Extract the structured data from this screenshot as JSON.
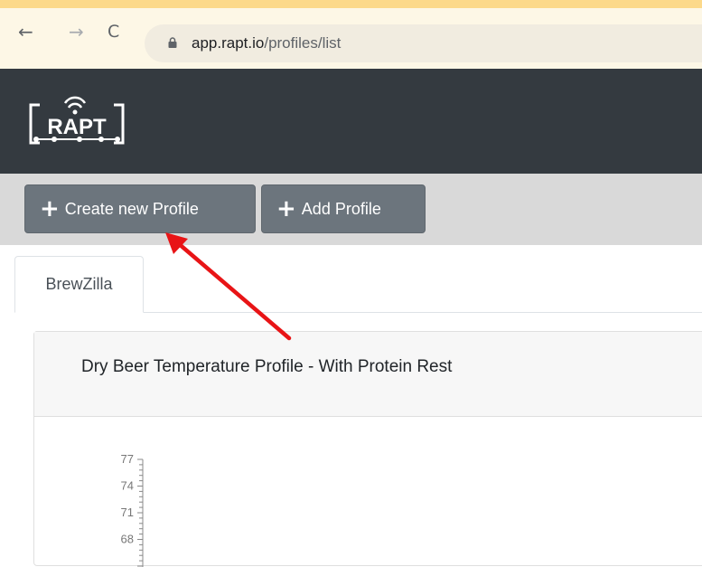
{
  "browser": {
    "url_domain": "app.rapt.io",
    "url_path": "/profiles/list",
    "back_icon": "arrow-left",
    "forward_icon": "arrow-right",
    "reload_icon": "reload",
    "lock_icon": "lock"
  },
  "app": {
    "logo_text": "RAPT"
  },
  "toolbar": {
    "create_label": "Create new Profile",
    "add_label": "Add Profile"
  },
  "tabs": [
    {
      "label": "BrewZilla"
    }
  ],
  "card": {
    "title": "Dry Beer Temperature Profile - With Protein Rest"
  },
  "chart_data": {
    "type": "line",
    "y_ticks": [
      "77",
      "74",
      "71",
      "68"
    ],
    "series": []
  },
  "annotation": {
    "arrow_color": "#e81416"
  }
}
